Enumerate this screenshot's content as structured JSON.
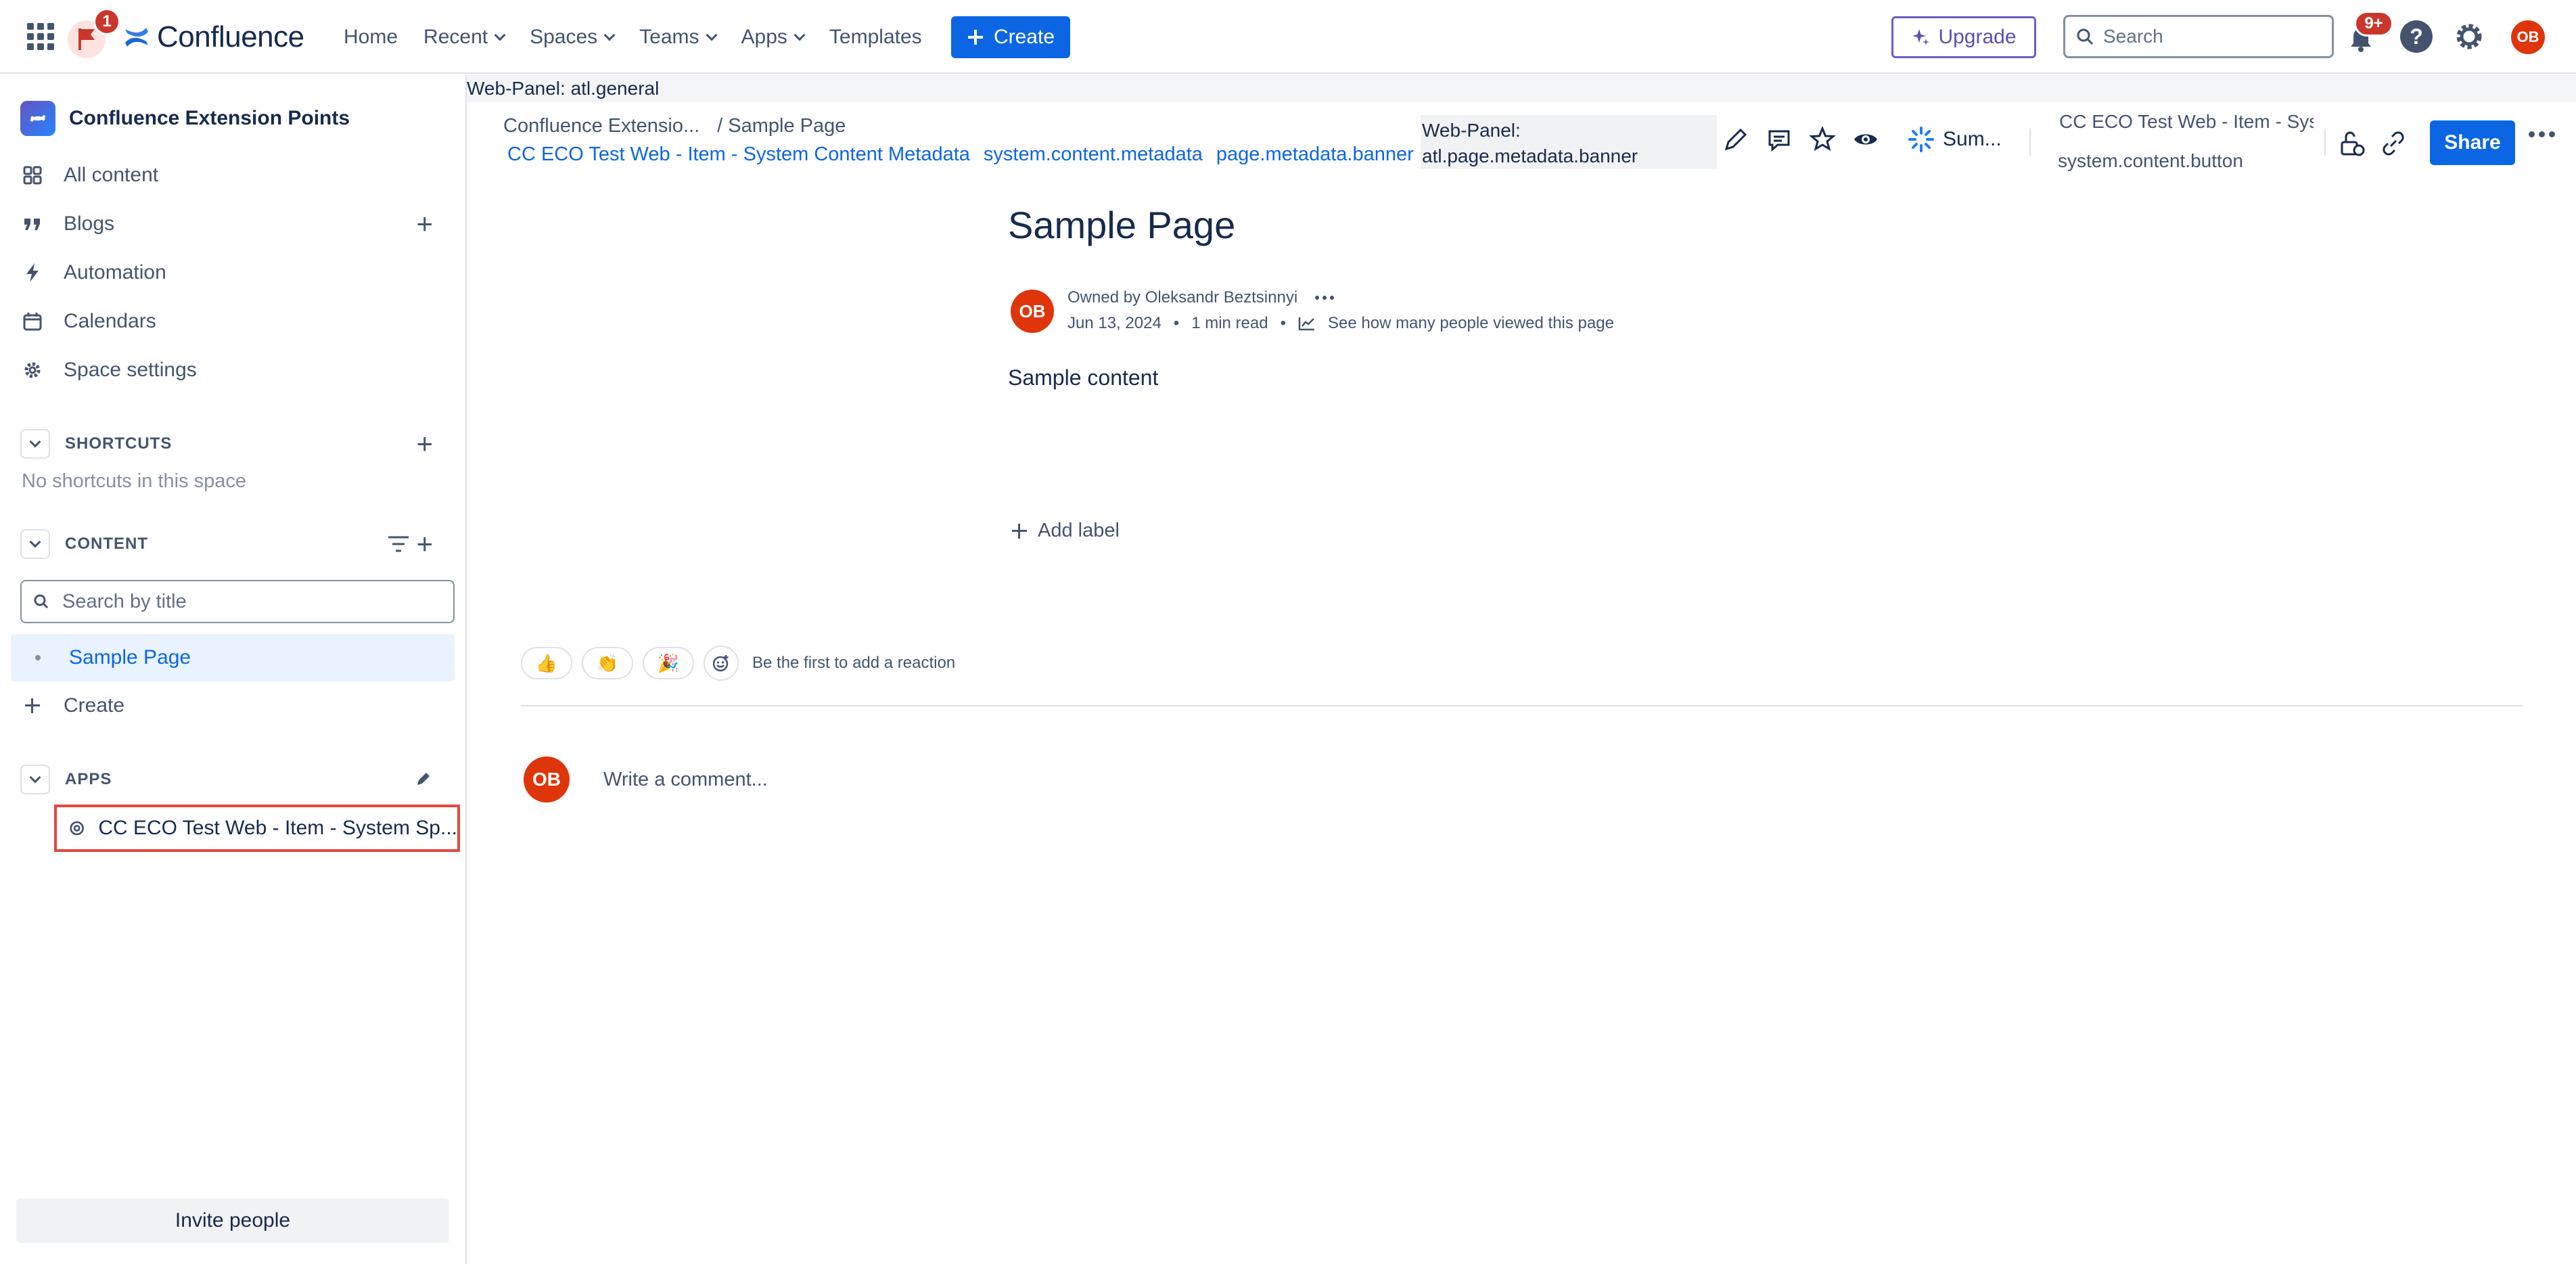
{
  "topnav": {
    "notification_flag_count": "1",
    "product_name": "Confluence",
    "items": [
      {
        "label": "Home",
        "dropdown": false
      },
      {
        "label": "Recent",
        "dropdown": true
      },
      {
        "label": "Spaces",
        "dropdown": true
      },
      {
        "label": "Teams",
        "dropdown": true
      },
      {
        "label": "Apps",
        "dropdown": true
      },
      {
        "label": "Templates",
        "dropdown": false
      }
    ],
    "create_label": "Create",
    "upgrade_label": "Upgrade",
    "search_placeholder": "Search",
    "notifications_count": "9+",
    "help_glyph": "?",
    "avatar_initials": "OB",
    "icons": [
      "app-switcher-icon",
      "flag-icon",
      "confluence-logo-icon",
      "plus-icon",
      "sparkle-icon",
      "search-icon",
      "bell-icon",
      "help-icon",
      "gear-icon"
    ],
    "colors": {
      "primary": "#0c66e4",
      "upgrade": "#5e4db2",
      "badge": "#c9372c",
      "avatar": "#de350b"
    }
  },
  "sidebar": {
    "space_name": "Confluence Extension Points",
    "links": [
      {
        "label": "All content",
        "icon": "grid-icon"
      },
      {
        "label": "Blogs",
        "icon": "quote-icon"
      },
      {
        "label": "Automation",
        "icon": "lightning-icon"
      },
      {
        "label": "Calendars",
        "icon": "calendar-icon"
      },
      {
        "label": "Space settings",
        "icon": "gear-icon"
      }
    ],
    "shortcuts_title": "SHORTCUTS",
    "shortcuts_empty": "No shortcuts in this space",
    "content_title": "CONTENT",
    "search_placeholder": "Search by title",
    "active_page": "Sample Page",
    "create_label": "Create",
    "apps_title": "APPS",
    "app_item": "CC ECO Test Web - Item - System Sp...",
    "invite_label": "Invite people"
  },
  "main": {
    "webpanel_general": "Web-Panel: atl.general",
    "breadcrumb": [
      "Confluence Extensio...",
      "/  Sample Page"
    ],
    "metadata_banner": [
      "CC ECO Test Web - Item - System Content Metadata",
      "system.content.metadata",
      "page.metadata.banner"
    ],
    "webpanel_metadata_line1": "Web-Panel:",
    "webpanel_metadata_line2": "atl.page.metadata.banner",
    "summarize_label": "Sum...",
    "cceco_item": "CC ECO Test Web - Item - System",
    "system_content_button": "system.content.button",
    "share_label": "Share",
    "page_title": "Sample Page",
    "owner_initials": "OB",
    "owned_by": "Owned by Oleksandr Beztsinnyi",
    "date": "Jun 13, 2024",
    "read_time": "1 min read",
    "views_link": "See how many people viewed this page",
    "body": "Sample content",
    "add_label": "Add label",
    "reactions": [
      "👍",
      "👏",
      "🎉"
    ],
    "reaction_prompt": "Be the first to add a reaction",
    "comment_avatar": "OB",
    "comment_placeholder": "Write a comment..."
  }
}
